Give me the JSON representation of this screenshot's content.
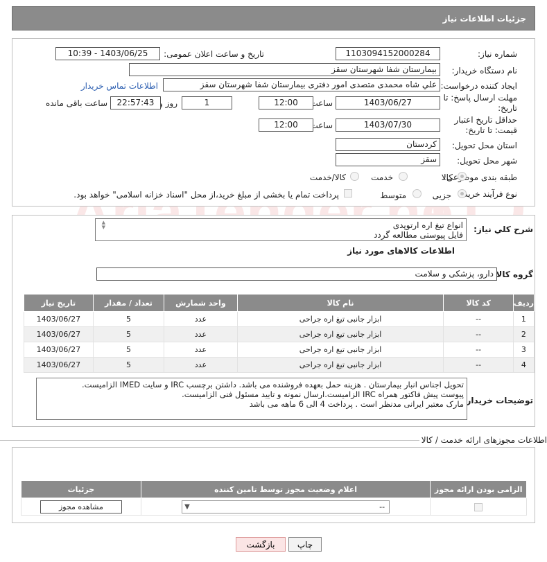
{
  "page_title": "جزئیات اطلاعات نیاز",
  "fields": {
    "need_number_label": "شماره نیاز:",
    "need_number": "1103094152000284",
    "announce_label": "تاریخ و ساعت اعلان عمومی:",
    "announce_value": "1403/06/25 - 10:39",
    "buyer_org_label": "نام دستگاه خریدار:",
    "buyer_org": "بیمارستان شفا شهرستان سقز",
    "creator_label": "ایجاد کننده درخواست:",
    "creator": "علي شاه محمدی متصدی امور دفتری بیمارستان شفا شهرستان سقز",
    "buyer_contact_link": "اطلاعات تماس خریدار",
    "deadline_label": "مهلت ارسال پاسخ: تا تاریخ:",
    "deadline_date": "1403/06/27",
    "time_label": "ساعت",
    "deadline_time": "12:00",
    "days_value": "1",
    "days_label": "روز و",
    "remaining_time": "22:57:43",
    "remaining_label": "ساعت باقی مانده",
    "validity_label": "حداقل تاریخ اعتبار قیمت: تا تاریخ:",
    "validity_date": "1403/07/30",
    "validity_time": "12:00",
    "province_label": "استان محل تحویل:",
    "province": "كردستان",
    "city_label": "شهر محل تحویل:",
    "city": "سقز",
    "category_label": "طبقه بندی موضوعی:",
    "category_options": [
      "كالا",
      "خدمت",
      "كالا/خدمت"
    ],
    "purchase_type_label": "نوع فرآیند خرید :",
    "purchase_type_options": [
      "جزیی",
      "متوسط"
    ],
    "payment_note": "پرداخت تمام یا بخشی از مبلغ خرید،از محل \"اسناد خزانه اسلامی\" خواهد بود."
  },
  "summary": {
    "label": "شرح کلي نياز:",
    "text_line1": "انواع تیغ اره ارتوپدی",
    "text_line2": "فایل پیوستی مطالعه گردد"
  },
  "goods_section_title": "اطلاعات کالاهای مورد نیاز",
  "goods_group": {
    "label": "گروه کالا:",
    "value": "دارو، پزشکی و سلامت"
  },
  "goods_table": {
    "headers": [
      "ردیف",
      "کد کالا",
      "نام کالا",
      "واحد شمارش",
      "تعداد / مقدار",
      "تاریخ نیاز"
    ],
    "rows": [
      {
        "row": "1",
        "code": "--",
        "name": "ابزار جانبی تیغ اره جراحی",
        "unit": "عدد",
        "qty": "5",
        "date": "1403/06/27"
      },
      {
        "row": "2",
        "code": "--",
        "name": "ابزار جانبی تیغ اره جراحی",
        "unit": "عدد",
        "qty": "5",
        "date": "1403/06/27"
      },
      {
        "row": "3",
        "code": "--",
        "name": "ابزار جانبی تیغ اره جراحی",
        "unit": "عدد",
        "qty": "5",
        "date": "1403/06/27"
      },
      {
        "row": "4",
        "code": "--",
        "name": "ابزار جانبی تیغ اره جراحی",
        "unit": "عدد",
        "qty": "5",
        "date": "1403/06/27"
      }
    ]
  },
  "buyer_notes": {
    "label": "توضیحات خریدار:",
    "line1": "تحویل اجناس  انبار بیمارستان . هزینه حمل بعهده فروشنده می باشد.  داشتن برچسب IRC  و سایت  IMED  الزامیست.",
    "line2": "پیوست پیش فاکتور همراه IRC  الزامیست.ارسال نمونه و تایید مسئول فنی الزامیست.",
    "line3": "مارک معتبر ایرانی مدنظر است . پرداخت 4 الی 6 ماهه می باشد"
  },
  "permits_title": "اطلاعات مجوزهای ارائه خدمت / کالا",
  "permits_table": {
    "headers": [
      "الزامی بودن ارائه مجوز",
      "اعلام وضعیت مجوز توسط تامین کننده",
      "جزئیات"
    ],
    "select_value": "--",
    "view_button": "مشاهده مجوز"
  },
  "buttons": {
    "print": "چاپ",
    "back": "بازگشت"
  },
  "watermark_text": "AriaTender.neT"
}
